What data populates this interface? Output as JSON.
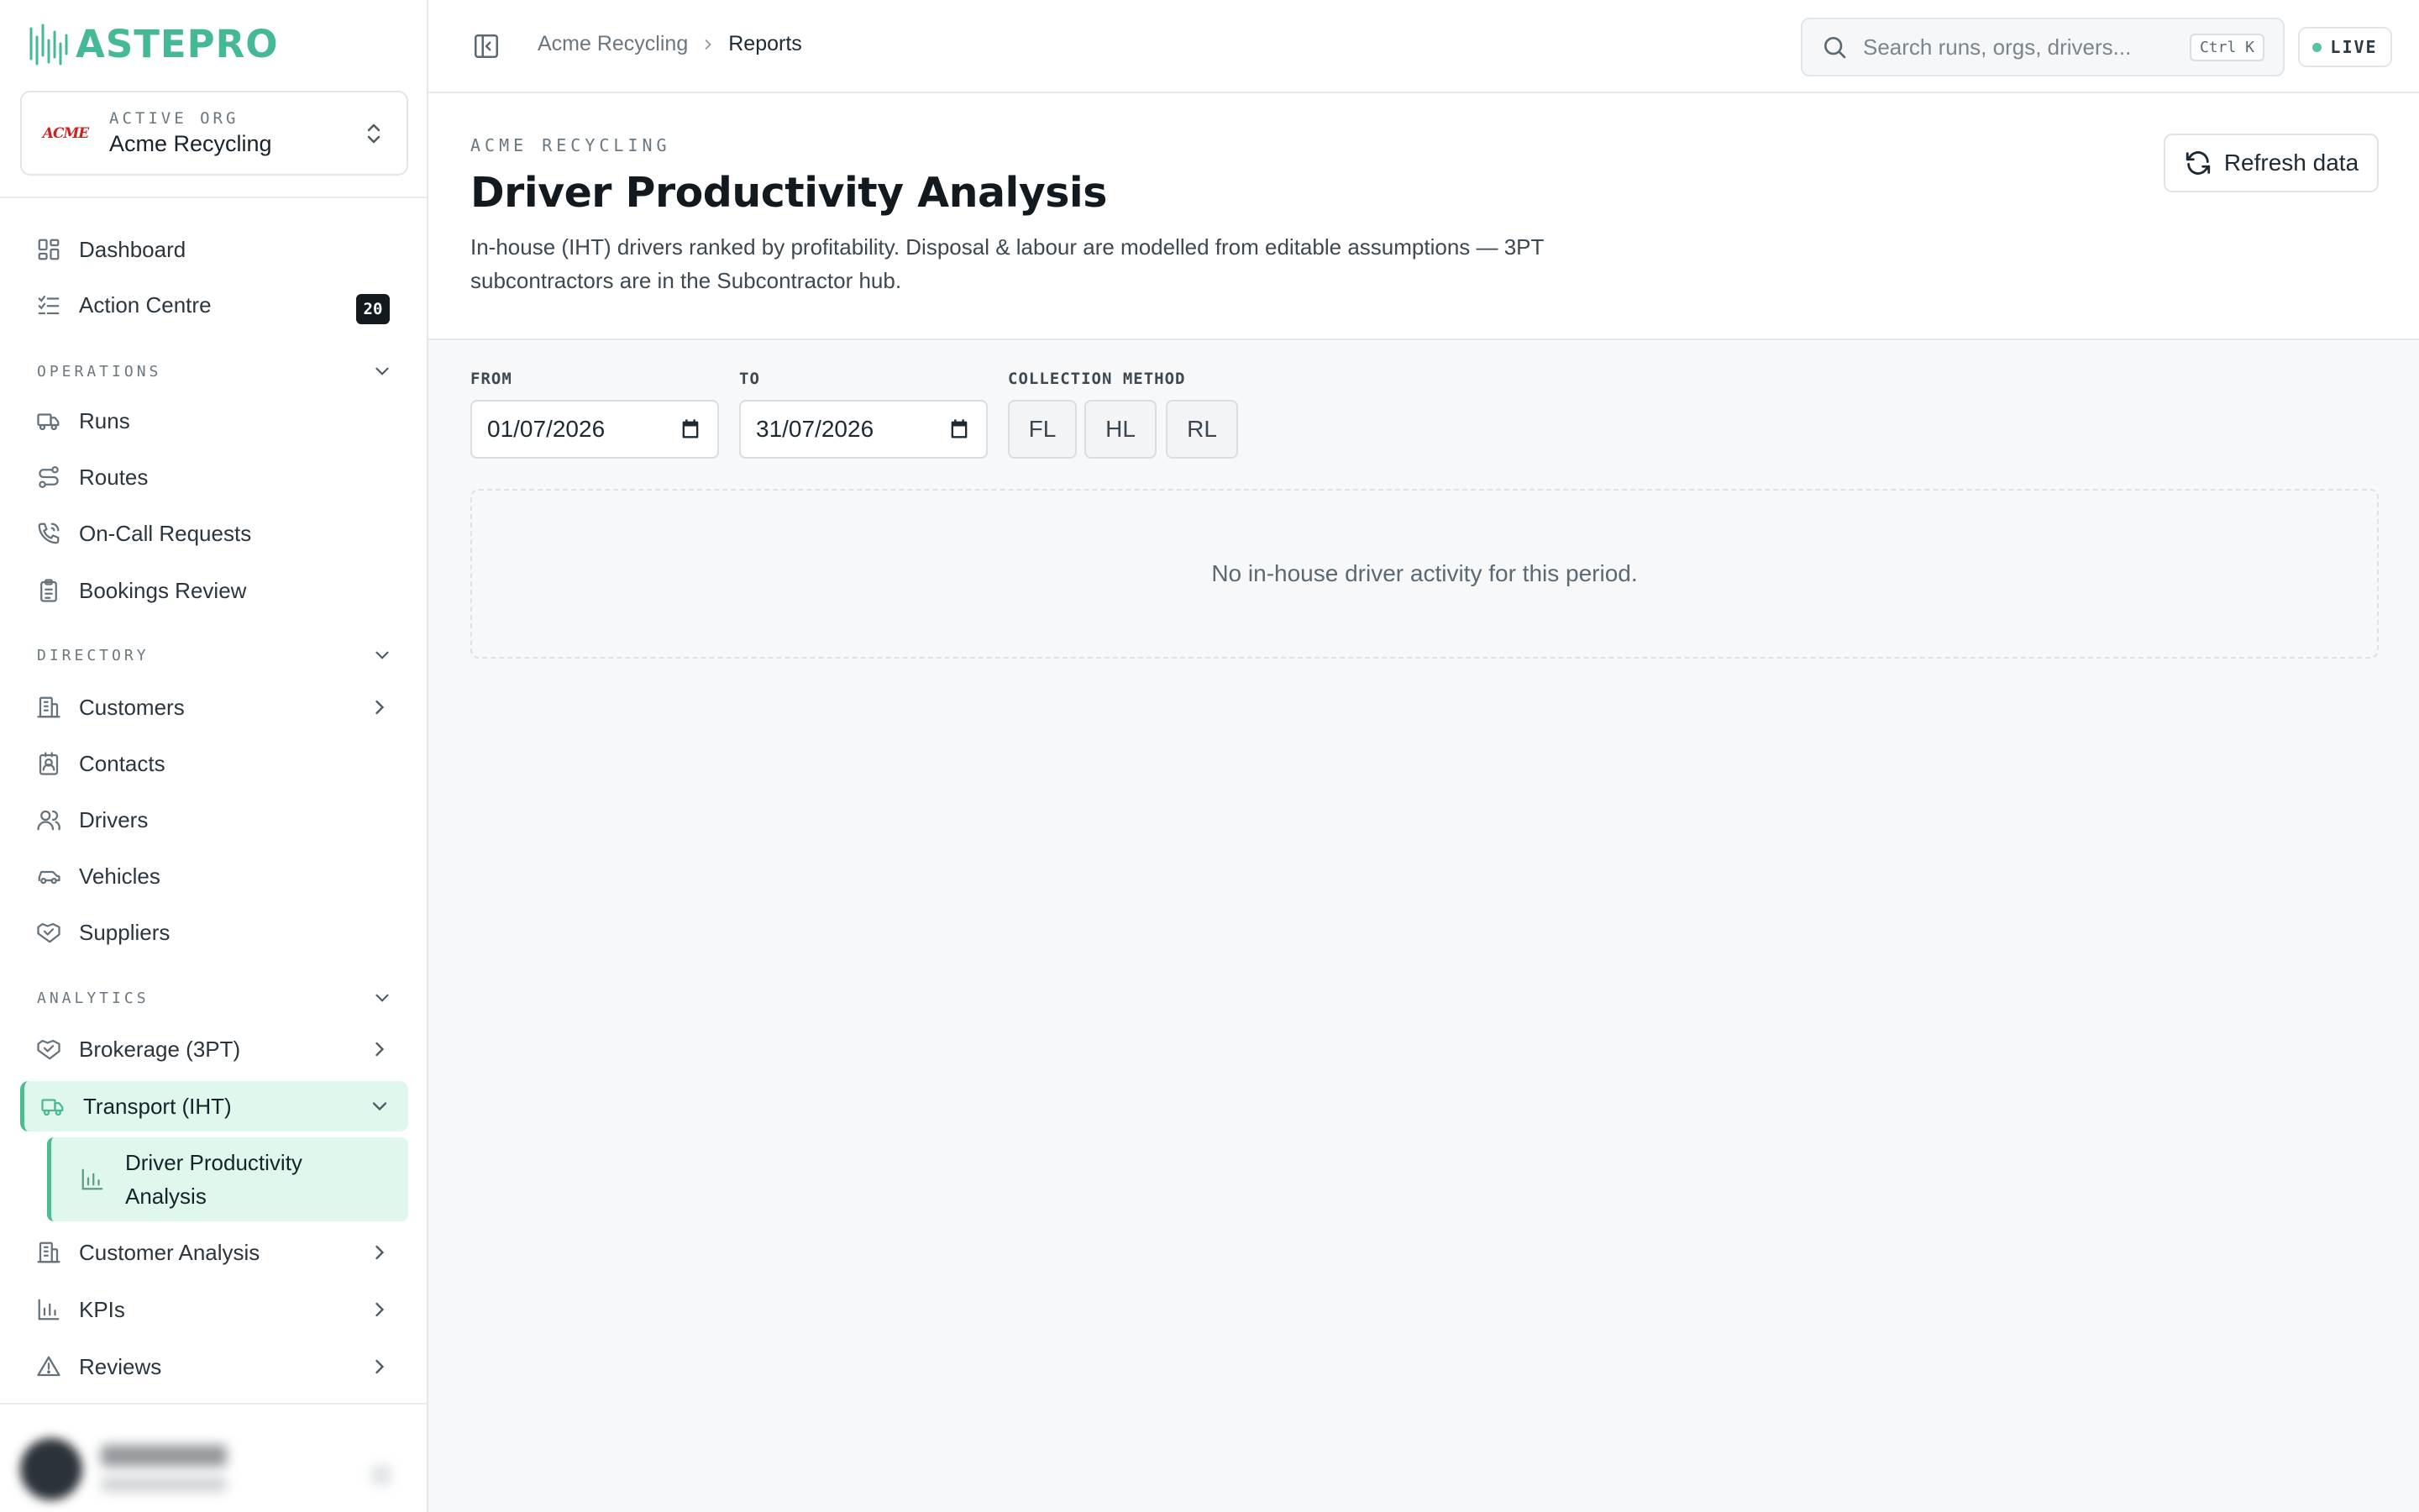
{
  "app": {
    "logo_text": "ASTEPRO",
    "brand_color": "#45b898"
  },
  "org": {
    "label": "ACTIVE ORG",
    "name": "Acme Recycling",
    "logo_text": "ACME"
  },
  "nav": {
    "top": [
      {
        "label": "Dashboard",
        "icon": "dashboard-icon"
      },
      {
        "label": "Action Centre",
        "icon": "checklist-icon",
        "badge": "20"
      }
    ],
    "sections": {
      "operations": "OPERATIONS",
      "directory": "DIRECTORY",
      "analytics": "ANALYTICS"
    },
    "operations": [
      {
        "label": "Runs",
        "icon": "truck-icon"
      },
      {
        "label": "Routes",
        "icon": "route-icon"
      },
      {
        "label": "On-Call Requests",
        "icon": "phone-call-icon"
      },
      {
        "label": "Bookings Review",
        "icon": "clipboard-icon"
      }
    ],
    "directory": [
      {
        "label": "Customers",
        "icon": "building-icon"
      },
      {
        "label": "Contacts",
        "icon": "contact-icon"
      },
      {
        "label": "Drivers",
        "icon": "users-icon"
      },
      {
        "label": "Vehicles",
        "icon": "car-icon"
      },
      {
        "label": "Suppliers",
        "icon": "handshake-icon"
      }
    ],
    "analytics": [
      {
        "label": "Brokerage (3PT)",
        "icon": "handshake-icon"
      },
      {
        "label": "Transport (IHT)",
        "icon": "truck-icon",
        "active": true
      },
      {
        "label": "Driver Productivity Analysis",
        "icon": "bar-chart-icon",
        "active": true
      },
      {
        "label": "Customer Analysis",
        "icon": "building-icon"
      },
      {
        "label": "KPIs",
        "icon": "bar-chart-icon"
      },
      {
        "label": "Reviews",
        "icon": "alert-triangle-icon"
      }
    ]
  },
  "topbar": {
    "breadcrumb": [
      "Acme Recycling",
      "Reports"
    ],
    "search_placeholder": "Search runs, orgs, drivers...",
    "search_shortcut": "Ctrl K",
    "live_label": "LIVE",
    "live_color": "#58c49d"
  },
  "page": {
    "eyebrow": "ACME RECYCLING",
    "title": "Driver Productivity Analysis",
    "description": "In-house (IHT) drivers ranked by profitability. Disposal & labour are modelled from editable assumptions — 3PT subcontractors are in the Subcontractor hub.",
    "refresh_label": "Refresh data"
  },
  "filters": {
    "from_label": "FROM",
    "from_value": "01/07/2026",
    "to_label": "TO",
    "to_value": "31/07/2026",
    "method_label": "COLLECTION METHOD",
    "methods": [
      "FL",
      "HL",
      "RL"
    ]
  },
  "empty_state": "No in-house driver activity for this period."
}
